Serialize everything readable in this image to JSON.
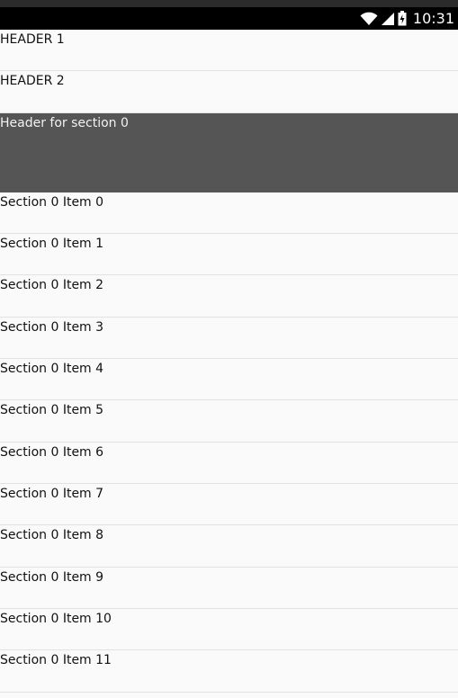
{
  "status_bar": {
    "time": "10:31",
    "icons": [
      "wifi-icon",
      "signal-icon",
      "battery-icon"
    ]
  },
  "list": {
    "headers": [
      {
        "label": "HEADER 1"
      },
      {
        "label": "HEADER 2"
      }
    ],
    "section_header": {
      "label": "Header for section 0"
    },
    "items": [
      {
        "label": "Section 0 Item 0"
      },
      {
        "label": "Section 0 Item 1"
      },
      {
        "label": "Section 0 Item 2"
      },
      {
        "label": "Section 0 Item 3"
      },
      {
        "label": "Section 0 Item 4"
      },
      {
        "label": "Section 0 Item 5"
      },
      {
        "label": "Section 0 Item 6"
      },
      {
        "label": "Section 0 Item 7"
      },
      {
        "label": "Section 0 Item 8"
      },
      {
        "label": "Section 0 Item 9"
      },
      {
        "label": "Section 0 Item 10"
      },
      {
        "label": "Section 0 Item 11"
      }
    ]
  },
  "colors": {
    "status_bar_bg": "#000000",
    "section_header_bg": "#555555",
    "list_bg": "#fafafa",
    "divider": "#e2e2e2"
  }
}
